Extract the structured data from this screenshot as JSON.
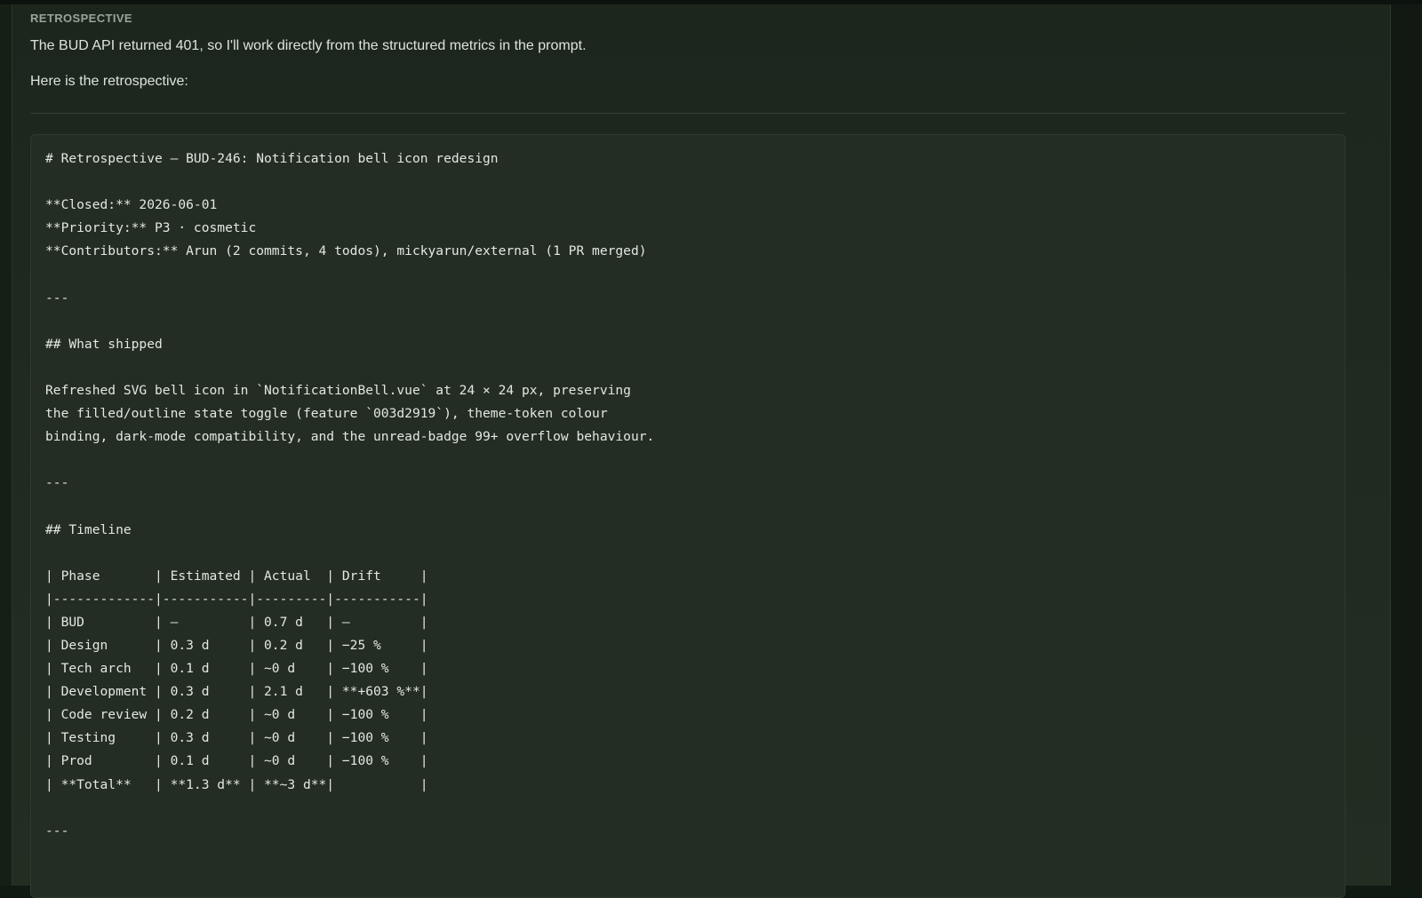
{
  "section": {
    "label": "RETROSPECTIVE"
  },
  "intro": {
    "line1": "The BUD API returned 401, so I'll work directly from the structured metrics in the prompt.",
    "line2": "Here is the retrospective:"
  },
  "code_lines": [
    "# Retrospective — BUD-246: Notification bell icon redesign",
    "",
    "**Closed:** 2026-06-01",
    "**Priority:** P3 · cosmetic",
    "**Contributors:** Arun (2 commits, 4 todos), mickyarun/external (1 PR merged)",
    "",
    "---",
    "",
    "## What shipped",
    "",
    "Refreshed SVG bell icon in `NotificationBell.vue` at 24 × 24 px, preserving",
    "the filled/outline state toggle (feature `003d2919`), theme-token colour",
    "binding, dark-mode compatibility, and the unread-badge 99+ overflow behaviour.",
    "",
    "---",
    "",
    "## Timeline",
    "",
    "| Phase       | Estimated | Actual  | Drift     |",
    "|-------------|-----------|---------|-----------|",
    "| BUD         | —         | 0.7 d   | —         |",
    "| Design      | 0.3 d     | 0.2 d   | −25 %     |",
    "| Tech arch   | 0.1 d     | ~0 d    | −100 %    |",
    "| Development | 0.3 d     | 2.1 d   | **+603 %**|",
    "| Code review | 0.2 d     | ~0 d    | −100 %    |",
    "| Testing     | 0.3 d     | ~0 d    | −100 %    |",
    "| Prod        | 0.1 d     | ~0 d    | −100 %    |",
    "| **Total**   | **1.3 d** | **~3 d**|           |",
    "",
    "---",
    ""
  ]
}
